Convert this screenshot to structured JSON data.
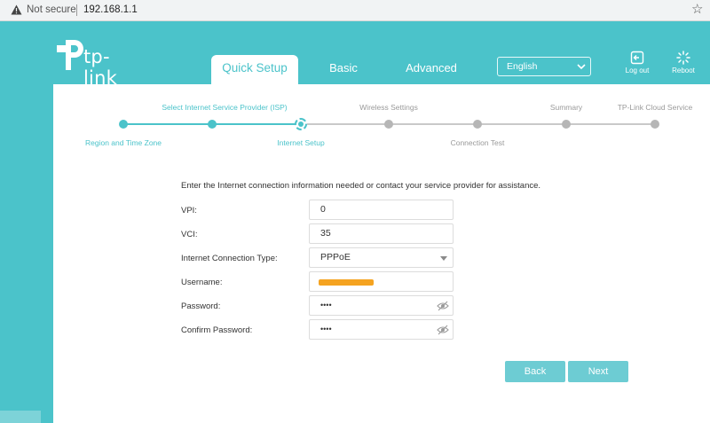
{
  "browser": {
    "security_label": "Not secure",
    "url": "192.168.1.1",
    "icons": [
      "warning-icon",
      "bookmark-star-icon"
    ]
  },
  "brand": {
    "logo_text": "tp-link",
    "accent_color": "#4bc3ca"
  },
  "nav": {
    "tabs": [
      {
        "label": "Quick Setup",
        "active": true
      },
      {
        "label": "Basic",
        "active": false
      },
      {
        "label": "Advanced",
        "active": false
      }
    ],
    "language": {
      "selected": "English"
    },
    "logout_label": "Log out",
    "reboot_label": "Reboot"
  },
  "stepper": {
    "steps": [
      {
        "label": "Region and Time Zone",
        "state": "done"
      },
      {
        "label": "Select Internet Service Provider (ISP)",
        "state": "done"
      },
      {
        "label": "Internet Setup",
        "state": "current"
      },
      {
        "label": "Wireless Settings",
        "state": "todo"
      },
      {
        "label": "Connection Test",
        "state": "todo"
      },
      {
        "label": "Summary",
        "state": "todo"
      },
      {
        "label": "TP-Link Cloud Service",
        "state": "todo"
      }
    ]
  },
  "form": {
    "instructions": "Enter the Internet connection information needed or contact your service provider for assistance.",
    "vpi": {
      "label": "VPI:",
      "value": "0"
    },
    "vci": {
      "label": "VCI:",
      "value": "35"
    },
    "connection_type": {
      "label": "Internet Connection Type:",
      "value": "PPPoE"
    },
    "username": {
      "label": "Username:",
      "value": ""
    },
    "password": {
      "label": "Password:",
      "value": "••••"
    },
    "confirm_password": {
      "label": "Confirm Password:",
      "value": "••••"
    }
  },
  "actions": {
    "back_label": "Back",
    "next_label": "Next"
  }
}
